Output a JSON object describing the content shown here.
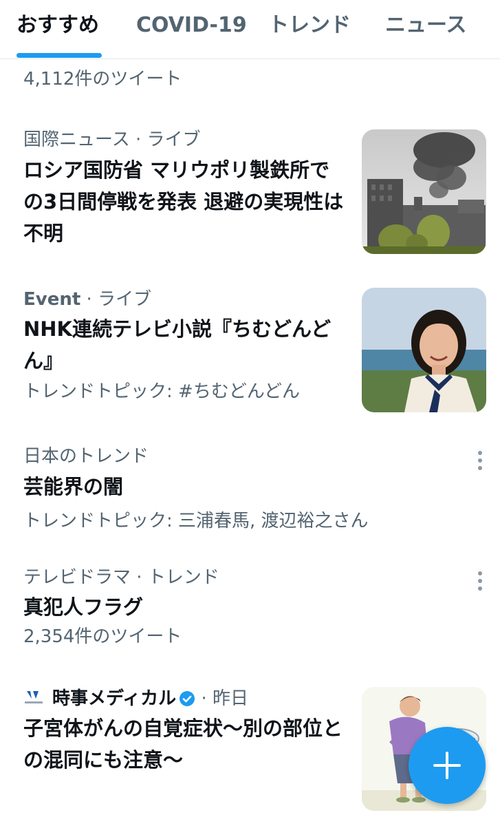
{
  "tabs": [
    {
      "label": "おすすめ",
      "active": true
    },
    {
      "label": "COVID-19",
      "active": false
    },
    {
      "label": "トレンド",
      "active": false
    },
    {
      "label": "ニュース",
      "active": false
    }
  ],
  "colors": {
    "accent": "#1d9bf0",
    "secondary_text": "#536471",
    "primary_text": "#0f1419"
  },
  "top_tweet_count": "4,112件のツイート",
  "items": [
    {
      "category": "国際ニュース",
      "separator": "·",
      "status": "ライブ",
      "headline": "ロシア国防省 マリウポリ製鉄所での3日間停戦を発表 退避の実現性は不明",
      "thumbnail_icon": "factory-smoke-photo"
    },
    {
      "category": "Event",
      "separator": "·",
      "status": "ライブ",
      "headline": "NHK連続テレビ小説『ちむどんどん』",
      "topic_label": "トレンドトピック:",
      "topic_value": "#ちむどんどん",
      "thumbnail_icon": "actress-portrait-photo"
    },
    {
      "category": "日本のトレンド",
      "headline": "芸能界の闇",
      "topic_label": "トレンドトピック:",
      "topic_value": "三浦春馬, 渡辺裕之さん",
      "menu_icon": "more-vertical-icon"
    },
    {
      "category": "テレビドラマ",
      "separator": "·",
      "status": "トレンド",
      "headline": "真犯人フラグ",
      "tweet_count": "2,354件のツイート",
      "menu_icon": "more-vertical-icon"
    },
    {
      "source": "時事メディカル",
      "separator": "·",
      "time": "昨日",
      "headline": "子宮体がんの自覚症状～別の部位との混同にも注意～",
      "thumbnail_icon": "medical-illustration"
    }
  ],
  "fab": {
    "icon": "plus-icon"
  }
}
